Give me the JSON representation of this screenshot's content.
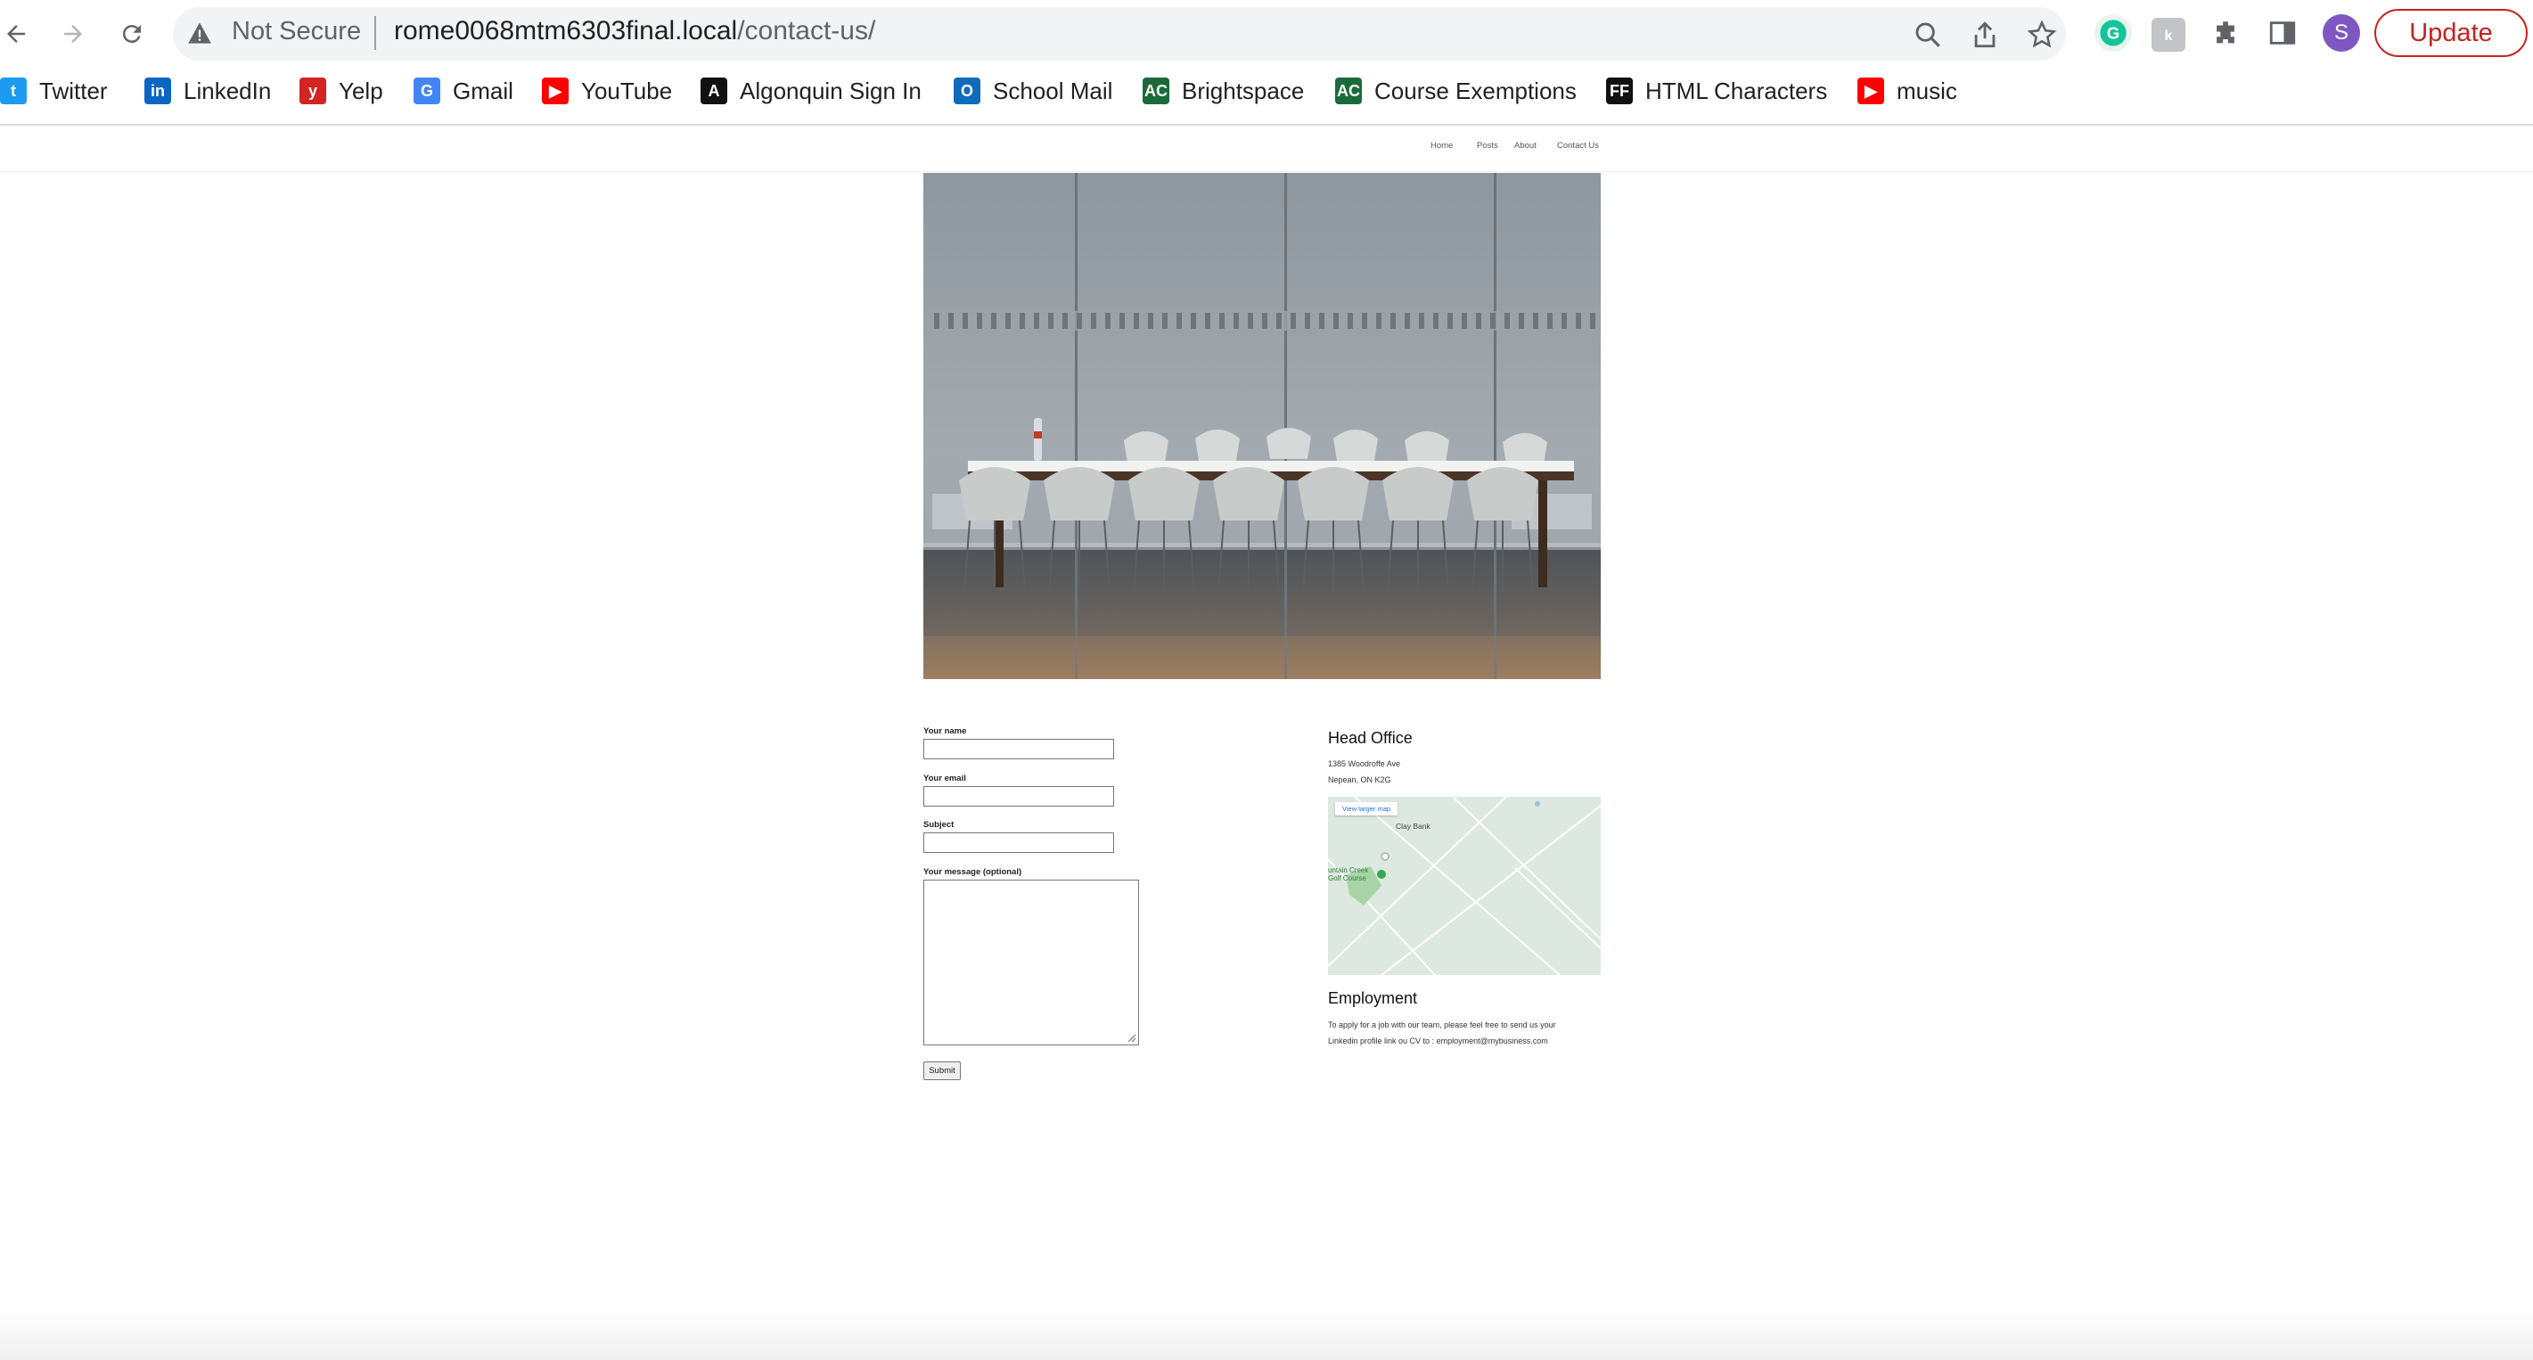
{
  "browser": {
    "not_secure": "Not Secure",
    "url_host": "rome0068mtm6303final.local",
    "url_path": "/contact-us/",
    "update_label": "Update",
    "profile_initial": "S"
  },
  "bookmarks": [
    {
      "label": "Twitter",
      "icon": "twitter-icon",
      "color": "#1d9bf0"
    },
    {
      "label": "LinkedIn",
      "icon": "linkedin-icon",
      "color": "#0a66c2"
    },
    {
      "label": "Yelp",
      "icon": "yelp-icon",
      "color": "#d32323"
    },
    {
      "label": "Gmail",
      "icon": "google-icon",
      "color": "#4285f4"
    },
    {
      "label": "YouTube",
      "icon": "youtube-icon",
      "color": "#ff0000"
    },
    {
      "label": "Algonquin Sign In",
      "icon": "algonquin-icon",
      "color": "#111111"
    },
    {
      "label": "School Mail",
      "icon": "outlook-icon",
      "color": "#0f6cbd"
    },
    {
      "label": "Brightspace",
      "icon": "brightspace-icon",
      "color": "#1b6b3a"
    },
    {
      "label": "Course Exemptions",
      "icon": "brightspace-icon",
      "color": "#1b6b3a"
    },
    {
      "label": "HTML Characters",
      "icon": "ff-icon",
      "color": "#111111"
    },
    {
      "label": "music",
      "icon": "youtube-icon",
      "color": "#ff0000"
    }
  ],
  "site_nav": [
    "Home",
    "Posts",
    "About",
    "Contact Us"
  ],
  "form": {
    "name_label": "Your name",
    "email_label": "Your email",
    "subject_label": "Subject",
    "message_label": "Your message (optional)",
    "submit_label": "Submit"
  },
  "head_office": {
    "title": "Head Office",
    "address_line1": "1385 Woodroffe Ave",
    "address_line2": "Nepean, ON K2G"
  },
  "map": {
    "view_larger": "View larger map",
    "place_label": "Clay Bank",
    "golf_label_1": "untain Creek",
    "golf_label_2": "Golf Course"
  },
  "employment": {
    "title": "Employment",
    "line1": "To apply for a job with our team, please feel free to send us your",
    "line2": "Linkedin profile link ou CV to : employment@mybusiness.com"
  }
}
